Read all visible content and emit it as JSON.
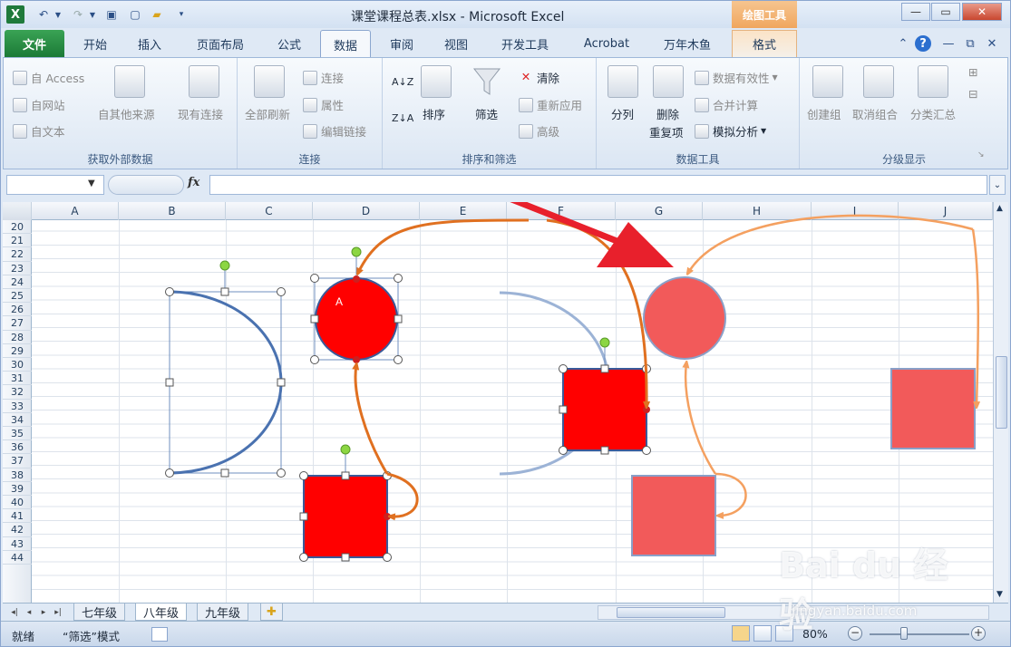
{
  "window": {
    "title": "课堂课程总表.xlsx - Microsoft Excel",
    "contextual_tab_title": "绘图工具",
    "app_icon_letter": "X"
  },
  "tabs": [
    "文件",
    "开始",
    "插入",
    "页面布局",
    "公式",
    "数据",
    "审阅",
    "视图",
    "开发工具",
    "Acrobat",
    "万年木鱼",
    "格式"
  ],
  "active_tab": "数据",
  "ribbon": {
    "get_external": {
      "label": "获取外部数据",
      "from_access": "自 Access",
      "from_web": "自网站",
      "from_text": "自文本",
      "from_other": "自其他来源",
      "existing": "现有连接"
    },
    "connections": {
      "label": "连接",
      "refresh_all": "全部刷新",
      "connections": "连接",
      "properties": "属性",
      "edit_links": "编辑链接"
    },
    "sort_filter": {
      "label": "排序和筛选",
      "sort": "排序",
      "filter": "筛选",
      "clear": "清除",
      "reapply": "重新应用",
      "advanced": "高级"
    },
    "data_tools": {
      "label": "数据工具",
      "text_to_columns": "分列",
      "remove_dup_1": "删除",
      "remove_dup_2": "重复项",
      "validation": "数据有效性",
      "consolidate": "合并计算",
      "what_if": "模拟分析"
    },
    "outline": {
      "label": "分级显示",
      "group": "创建组",
      "ungroup": "取消组合",
      "subtotal": "分类汇总"
    }
  },
  "formula_bar": {
    "name_box": "",
    "fx": "fx",
    "content": ""
  },
  "columns": [
    "A",
    "B",
    "C",
    "D",
    "E",
    "F",
    "G",
    "H",
    "I",
    "J"
  ],
  "rows": [
    "20",
    "21",
    "22",
    "23",
    "24",
    "25",
    "26",
    "27",
    "28",
    "29",
    "30",
    "31",
    "32",
    "33",
    "34",
    "35",
    "36",
    "37",
    "38",
    "39",
    "40",
    "41",
    "42",
    "43",
    "44"
  ],
  "shape_text": "A",
  "sheet_tabs": [
    "七年级",
    "八年级",
    "九年级"
  ],
  "active_sheet": "八年级",
  "status": {
    "ready": "就绪",
    "mode": "“筛选”模式",
    "zoom": "80%"
  },
  "watermark": {
    "brand": "Bai du 经验",
    "url": "jingyan.baidu.com"
  },
  "colors": {
    "accent_red": "#ff0000",
    "arc_blue": "#4a72b0",
    "connector_orange": "#e07020",
    "arrow_red": "#e8202c"
  }
}
